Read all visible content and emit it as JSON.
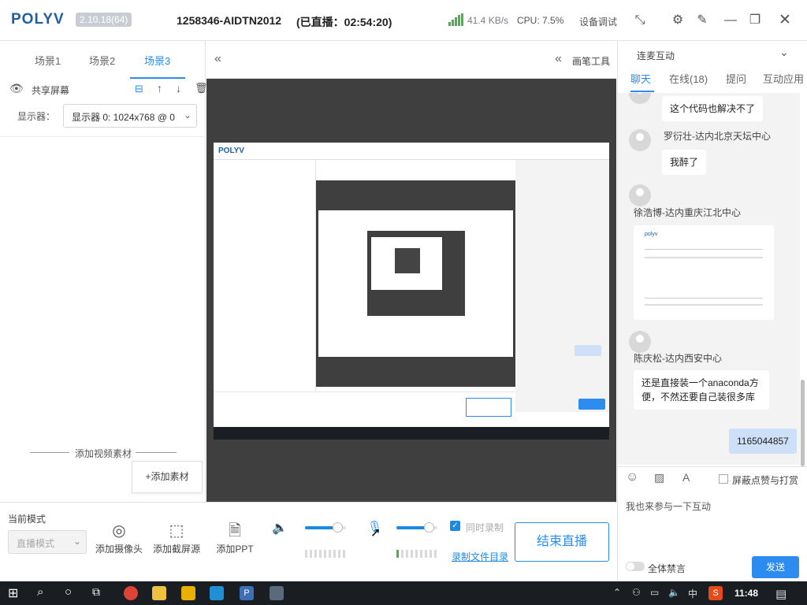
{
  "titlebar": {
    "logo": "POLYV",
    "version": "2.10.18(64)",
    "room_id": "1258346-AIDTN2012",
    "live_status": "(已直播：02:54:20)",
    "net_speed": "41.4 KB/s",
    "cpu": "CPU: 7.5%",
    "debug": "设备调试"
  },
  "scenes": {
    "tabs": [
      "场景1",
      "场景2",
      "场景3"
    ],
    "active_index": 2,
    "source_name": "共享屏幕",
    "display_label": "显示器：",
    "display_value": "显示器 0: 1024x768 @ 0",
    "add_video": "添加视频素材",
    "add_material": "+添加素材"
  },
  "center": {
    "pen_tool": "画笔工具"
  },
  "bottom": {
    "mode_label": "当前模式",
    "mode_value": "直播模式",
    "tools": [
      "添加摄像头",
      "添加截屏源",
      "添加PPT"
    ],
    "volume_level": 0.78,
    "mic_level": 0.04,
    "mic2_level": 0.78,
    "sync_record": "同时录制",
    "record_dir": "录制文件目录",
    "end_live": "结束直播"
  },
  "right": {
    "connect": "连麦互动",
    "tabs": [
      "聊天",
      "在线(18)",
      "提问",
      "互动应用"
    ],
    "active_tab": 0,
    "messages": [
      {
        "name": "",
        "text": "这个代码也解决不了"
      },
      {
        "name": "罗衍壮-达内北京天坛中心",
        "text": "我醉了"
      },
      {
        "name": "徐浩博-达内重庆江北中心",
        "text": ""
      },
      {
        "name": "陈庆松-达内西安中心",
        "text": "还是直接装一个anaconda方便，不然还要自己装很多库"
      }
    ],
    "self_message": "1165044857",
    "shield_label": "屏蔽点赞与打赏",
    "input_text": "我也来参与一下互动",
    "mute_all": "全体禁言",
    "send": "发送"
  },
  "taskbar": {
    "time": "11:48",
    "ime": "中"
  },
  "colors": {
    "accent": "#2d8cf0",
    "logo": "#1e5fa8",
    "canvas": "#3f3f3f"
  }
}
